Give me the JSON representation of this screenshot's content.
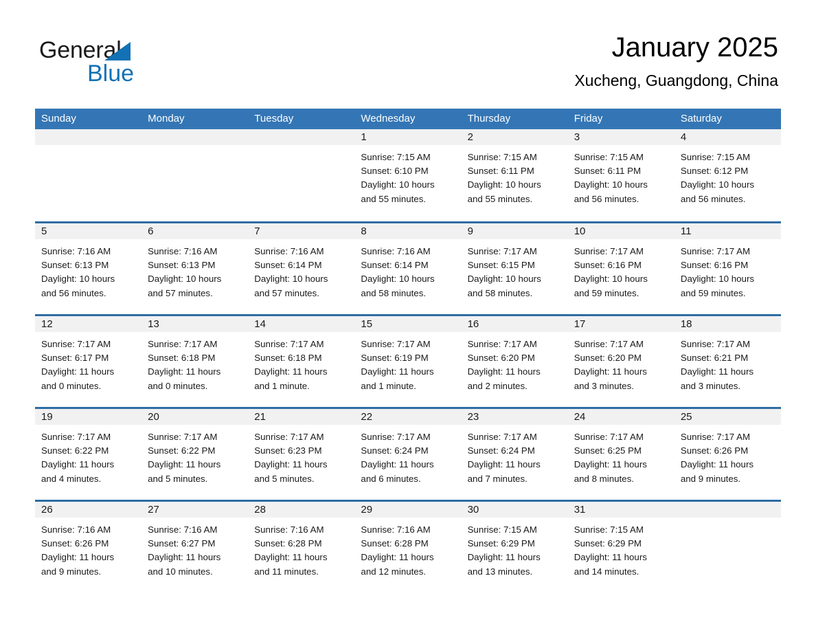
{
  "brand": {
    "name_part1": "General",
    "name_part2": "Blue",
    "accent_color": "#1272b5"
  },
  "header": {
    "month_title": "January 2025",
    "location": "Xucheng, Guangdong, China"
  },
  "theme": {
    "header_row_bg": "#3476b5",
    "week_separator": "#2e6da4",
    "day_band_bg": "#f1f1f1"
  },
  "weekdays": [
    "Sunday",
    "Monday",
    "Tuesday",
    "Wednesday",
    "Thursday",
    "Friday",
    "Saturday"
  ],
  "weeks": [
    [
      {
        "day": "",
        "lines": []
      },
      {
        "day": "",
        "lines": []
      },
      {
        "day": "",
        "lines": []
      },
      {
        "day": "1",
        "lines": [
          "Sunrise: 7:15 AM",
          "Sunset: 6:10 PM",
          "Daylight: 10 hours",
          "and 55 minutes."
        ]
      },
      {
        "day": "2",
        "lines": [
          "Sunrise: 7:15 AM",
          "Sunset: 6:11 PM",
          "Daylight: 10 hours",
          "and 55 minutes."
        ]
      },
      {
        "day": "3",
        "lines": [
          "Sunrise: 7:15 AM",
          "Sunset: 6:11 PM",
          "Daylight: 10 hours",
          "and 56 minutes."
        ]
      },
      {
        "day": "4",
        "lines": [
          "Sunrise: 7:15 AM",
          "Sunset: 6:12 PM",
          "Daylight: 10 hours",
          "and 56 minutes."
        ]
      }
    ],
    [
      {
        "day": "5",
        "lines": [
          "Sunrise: 7:16 AM",
          "Sunset: 6:13 PM",
          "Daylight: 10 hours",
          "and 56 minutes."
        ]
      },
      {
        "day": "6",
        "lines": [
          "Sunrise: 7:16 AM",
          "Sunset: 6:13 PM",
          "Daylight: 10 hours",
          "and 57 minutes."
        ]
      },
      {
        "day": "7",
        "lines": [
          "Sunrise: 7:16 AM",
          "Sunset: 6:14 PM",
          "Daylight: 10 hours",
          "and 57 minutes."
        ]
      },
      {
        "day": "8",
        "lines": [
          "Sunrise: 7:16 AM",
          "Sunset: 6:14 PM",
          "Daylight: 10 hours",
          "and 58 minutes."
        ]
      },
      {
        "day": "9",
        "lines": [
          "Sunrise: 7:17 AM",
          "Sunset: 6:15 PM",
          "Daylight: 10 hours",
          "and 58 minutes."
        ]
      },
      {
        "day": "10",
        "lines": [
          "Sunrise: 7:17 AM",
          "Sunset: 6:16 PM",
          "Daylight: 10 hours",
          "and 59 minutes."
        ]
      },
      {
        "day": "11",
        "lines": [
          "Sunrise: 7:17 AM",
          "Sunset: 6:16 PM",
          "Daylight: 10 hours",
          "and 59 minutes."
        ]
      }
    ],
    [
      {
        "day": "12",
        "lines": [
          "Sunrise: 7:17 AM",
          "Sunset: 6:17 PM",
          "Daylight: 11 hours",
          "and 0 minutes."
        ]
      },
      {
        "day": "13",
        "lines": [
          "Sunrise: 7:17 AM",
          "Sunset: 6:18 PM",
          "Daylight: 11 hours",
          "and 0 minutes."
        ]
      },
      {
        "day": "14",
        "lines": [
          "Sunrise: 7:17 AM",
          "Sunset: 6:18 PM",
          "Daylight: 11 hours",
          "and 1 minute."
        ]
      },
      {
        "day": "15",
        "lines": [
          "Sunrise: 7:17 AM",
          "Sunset: 6:19 PM",
          "Daylight: 11 hours",
          "and 1 minute."
        ]
      },
      {
        "day": "16",
        "lines": [
          "Sunrise: 7:17 AM",
          "Sunset: 6:20 PM",
          "Daylight: 11 hours",
          "and 2 minutes."
        ]
      },
      {
        "day": "17",
        "lines": [
          "Sunrise: 7:17 AM",
          "Sunset: 6:20 PM",
          "Daylight: 11 hours",
          "and 3 minutes."
        ]
      },
      {
        "day": "18",
        "lines": [
          "Sunrise: 7:17 AM",
          "Sunset: 6:21 PM",
          "Daylight: 11 hours",
          "and 3 minutes."
        ]
      }
    ],
    [
      {
        "day": "19",
        "lines": [
          "Sunrise: 7:17 AM",
          "Sunset: 6:22 PM",
          "Daylight: 11 hours",
          "and 4 minutes."
        ]
      },
      {
        "day": "20",
        "lines": [
          "Sunrise: 7:17 AM",
          "Sunset: 6:22 PM",
          "Daylight: 11 hours",
          "and 5 minutes."
        ]
      },
      {
        "day": "21",
        "lines": [
          "Sunrise: 7:17 AM",
          "Sunset: 6:23 PM",
          "Daylight: 11 hours",
          "and 5 minutes."
        ]
      },
      {
        "day": "22",
        "lines": [
          "Sunrise: 7:17 AM",
          "Sunset: 6:24 PM",
          "Daylight: 11 hours",
          "and 6 minutes."
        ]
      },
      {
        "day": "23",
        "lines": [
          "Sunrise: 7:17 AM",
          "Sunset: 6:24 PM",
          "Daylight: 11 hours",
          "and 7 minutes."
        ]
      },
      {
        "day": "24",
        "lines": [
          "Sunrise: 7:17 AM",
          "Sunset: 6:25 PM",
          "Daylight: 11 hours",
          "and 8 minutes."
        ]
      },
      {
        "day": "25",
        "lines": [
          "Sunrise: 7:17 AM",
          "Sunset: 6:26 PM",
          "Daylight: 11 hours",
          "and 9 minutes."
        ]
      }
    ],
    [
      {
        "day": "26",
        "lines": [
          "Sunrise: 7:16 AM",
          "Sunset: 6:26 PM",
          "Daylight: 11 hours",
          "and 9 minutes."
        ]
      },
      {
        "day": "27",
        "lines": [
          "Sunrise: 7:16 AM",
          "Sunset: 6:27 PM",
          "Daylight: 11 hours",
          "and 10 minutes."
        ]
      },
      {
        "day": "28",
        "lines": [
          "Sunrise: 7:16 AM",
          "Sunset: 6:28 PM",
          "Daylight: 11 hours",
          "and 11 minutes."
        ]
      },
      {
        "day": "29",
        "lines": [
          "Sunrise: 7:16 AM",
          "Sunset: 6:28 PM",
          "Daylight: 11 hours",
          "and 12 minutes."
        ]
      },
      {
        "day": "30",
        "lines": [
          "Sunrise: 7:15 AM",
          "Sunset: 6:29 PM",
          "Daylight: 11 hours",
          "and 13 minutes."
        ]
      },
      {
        "day": "31",
        "lines": [
          "Sunrise: 7:15 AM",
          "Sunset: 6:29 PM",
          "Daylight: 11 hours",
          "and 14 minutes."
        ]
      },
      {
        "day": "",
        "lines": []
      }
    ]
  ]
}
